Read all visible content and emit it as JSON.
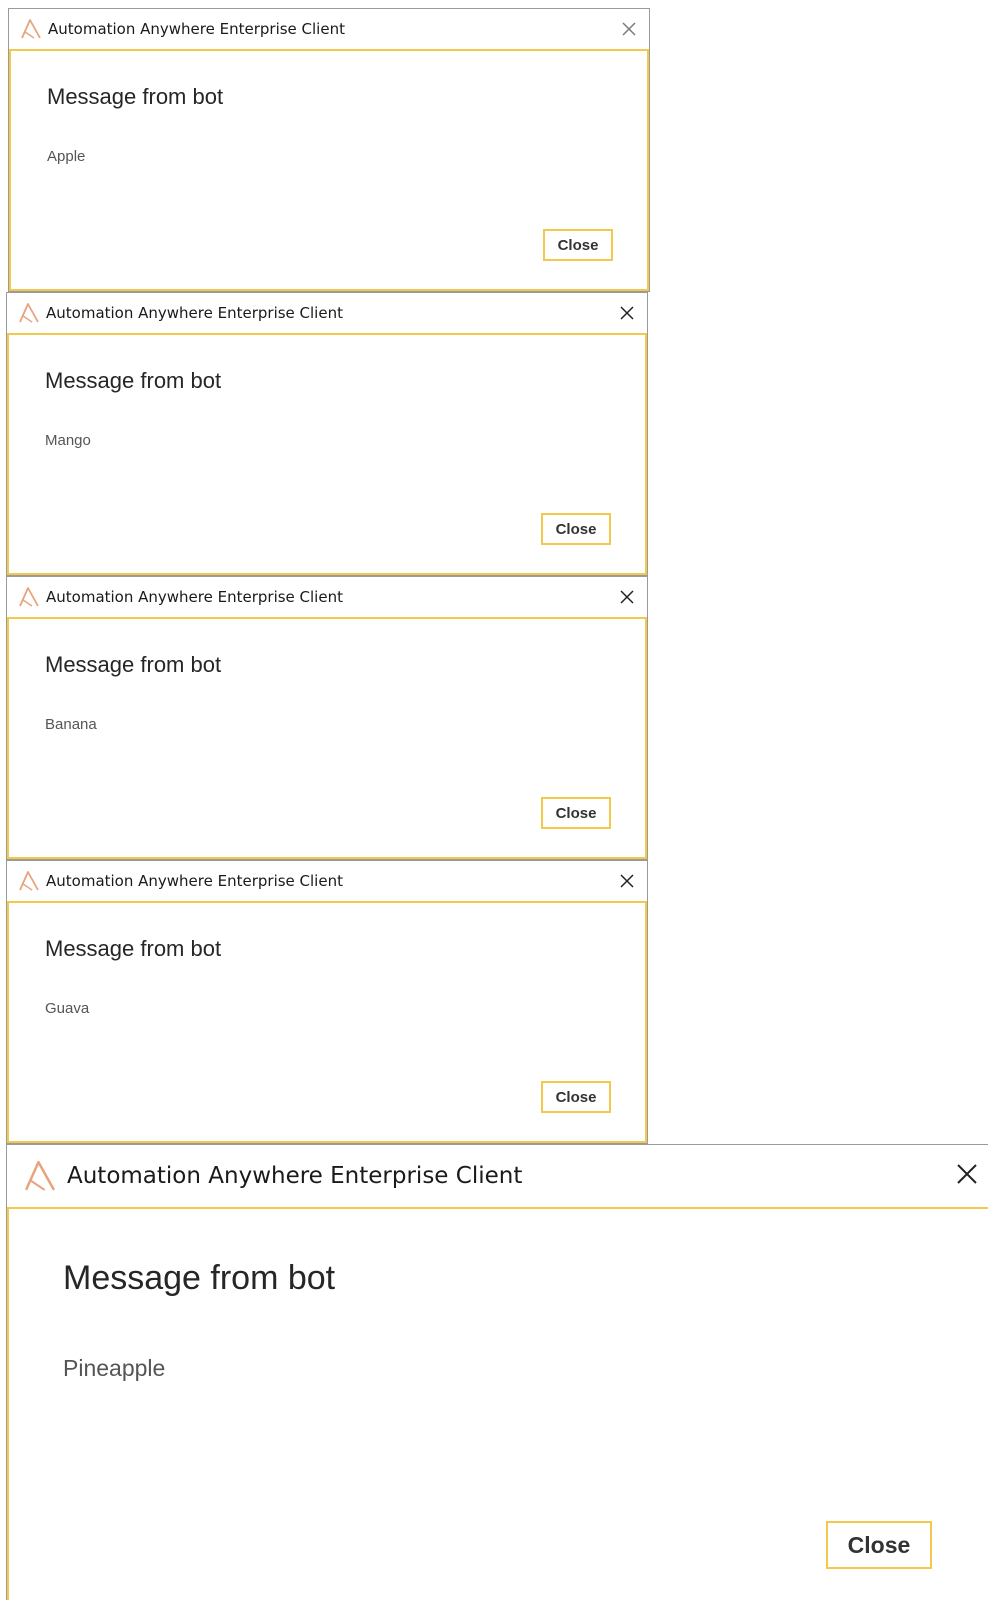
{
  "colors": {
    "accent_border": "#f2c94c",
    "logo": "#e8a37c",
    "title_text": "#1a1a1a",
    "message_text": "#555555"
  },
  "dialogs": [
    {
      "title": "Automation Anywhere Enterprise Client",
      "logo_icon": "automation-anywhere-logo-icon",
      "close_icon": "close-icon",
      "heading": "Message from bot",
      "message": "Apple",
      "button_label": "Close"
    },
    {
      "title": "Automation Anywhere Enterprise Client",
      "logo_icon": "automation-anywhere-logo-icon",
      "close_icon": "close-icon",
      "heading": "Message from bot",
      "message": "Mango",
      "button_label": "Close"
    },
    {
      "title": "Automation Anywhere Enterprise Client",
      "logo_icon": "automation-anywhere-logo-icon",
      "close_icon": "close-icon",
      "heading": "Message from bot",
      "message": "Banana",
      "button_label": "Close"
    },
    {
      "title": "Automation Anywhere Enterprise Client",
      "logo_icon": "automation-anywhere-logo-icon",
      "close_icon": "close-icon",
      "heading": "Message from bot",
      "message": "Guava",
      "button_label": "Close"
    },
    {
      "title": "Automation Anywhere Enterprise Client",
      "logo_icon": "automation-anywhere-logo-icon",
      "close_icon": "close-icon",
      "heading": "Message from bot",
      "message": "Pineapple",
      "button_label": "Close"
    }
  ]
}
